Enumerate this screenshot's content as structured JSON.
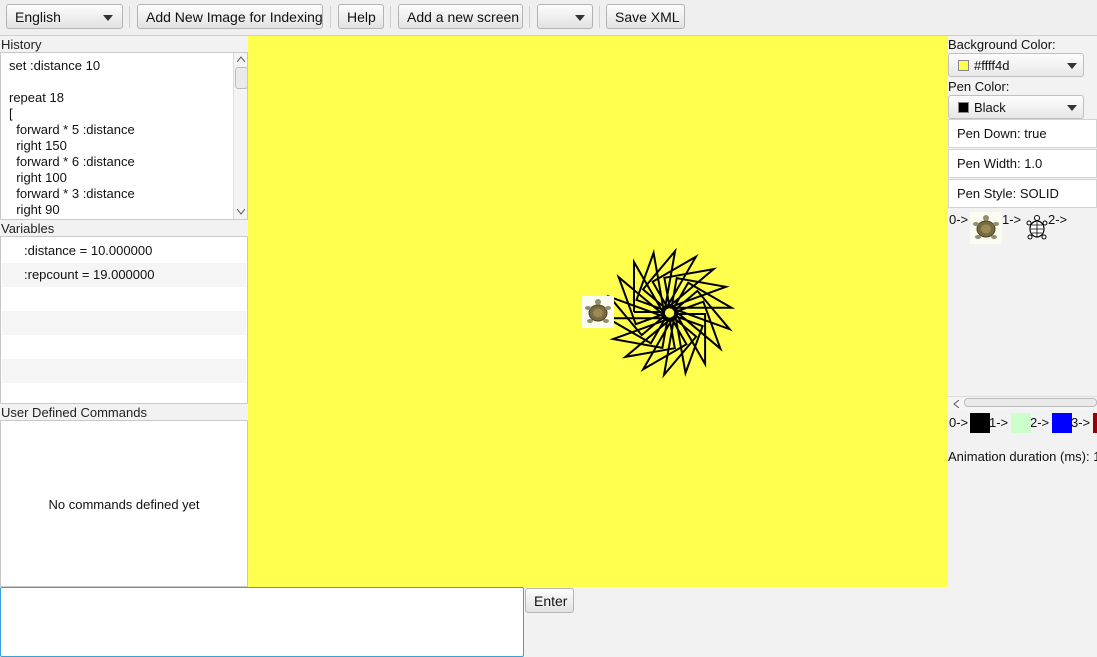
{
  "toolbar": {
    "language": "English",
    "add_image": "Add New Image for Indexing",
    "help": "Help",
    "add_screen": "Add a new screen",
    "save_xml": "Save XML"
  },
  "history": {
    "title": "History",
    "lines": [
      "set :distance 10",
      "",
      "repeat 18",
      "[",
      "  forward * 5 :distance",
      "  right 150",
      "  forward * 6 :distance",
      "  right 100",
      "  forward * 3 :distance",
      "  right 90"
    ]
  },
  "variables": {
    "title": "Variables",
    "rows": [
      ":distance = 10.000000",
      ":repcount = 19.000000"
    ]
  },
  "commands": {
    "title": "User Defined Commands",
    "empty": "No commands defined yet"
  },
  "input": {
    "enter": "Enter"
  },
  "canvas": {
    "background": "#ffff4d",
    "pen": "#000000"
  },
  "right": {
    "bg_label": "Background Color:",
    "bg_value": "#ffff4d",
    "pen_label": "Pen Color:",
    "pen_value": "Black",
    "pen_down": "Pen Down: true",
    "pen_width": "Pen Width: 1.0",
    "pen_style": "Pen Style: SOLID",
    "turtles": [
      "0->",
      "1->",
      "2->"
    ],
    "palette": [
      {
        "label": "0->",
        "color": "#000000"
      },
      {
        "label": "1->",
        "color": "#ccffcc"
      },
      {
        "label": "2->",
        "color": "#0000ff"
      },
      {
        "label": "3->",
        "color": "#990000"
      }
    ],
    "anim": "Animation duration (ms): 1"
  }
}
